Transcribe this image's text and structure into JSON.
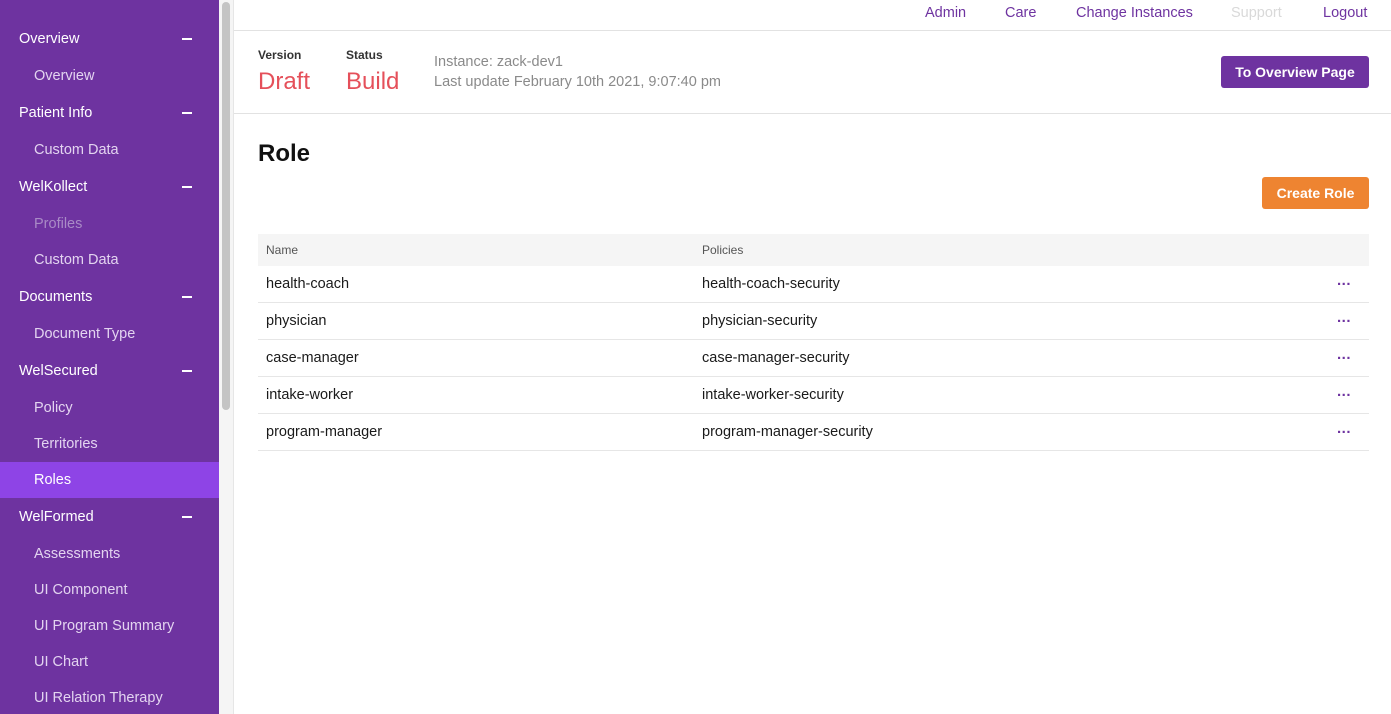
{
  "sidebar": {
    "groups": [
      {
        "label": "Overview",
        "items": [
          {
            "label": "Overview"
          }
        ]
      },
      {
        "label": "Patient Info",
        "items": [
          {
            "label": "Custom Data"
          }
        ]
      },
      {
        "label": "WelKollect",
        "items": [
          {
            "label": "Profiles"
          },
          {
            "label": "Custom Data"
          }
        ]
      },
      {
        "label": "Documents",
        "items": [
          {
            "label": "Document Type"
          }
        ]
      },
      {
        "label": "WelSecured",
        "items": [
          {
            "label": "Policy"
          },
          {
            "label": "Territories"
          },
          {
            "label": "Roles"
          }
        ]
      },
      {
        "label": "WelFormed",
        "items": [
          {
            "label": "Assessments"
          },
          {
            "label": "UI Component"
          },
          {
            "label": "UI Program Summary"
          },
          {
            "label": "UI Chart"
          },
          {
            "label": "UI Relation Therapy"
          }
        ]
      }
    ],
    "active_item": "Roles",
    "accent_color": "#6e33a0",
    "active_color": "#8e44e6"
  },
  "topnav": {
    "admin": "Admin",
    "care": "Care",
    "change_instances": "Change Instances",
    "support": "Support",
    "logout": "Logout"
  },
  "header": {
    "version_label": "Version",
    "version_value": "Draft",
    "status_label": "Status",
    "status_value": "Build",
    "instance": "Instance: zack-dev1",
    "last_update": "Last update February 10th 2021, 9:07:40 pm",
    "overview_button": "To Overview Page"
  },
  "main": {
    "title": "Role",
    "create_button": "Create Role",
    "table": {
      "headers": {
        "name": "Name",
        "policies": "Policies"
      },
      "rows": [
        {
          "name": "health-coach",
          "policies": "health-coach-security",
          "more": "..."
        },
        {
          "name": "physician",
          "policies": "physician-security",
          "more": "..."
        },
        {
          "name": "case-manager",
          "policies": "case-manager-security",
          "more": "..."
        },
        {
          "name": "intake-worker",
          "policies": "intake-worker-security",
          "more": "..."
        },
        {
          "name": "program-manager",
          "policies": "program-manager-security",
          "more": "..."
        }
      ]
    }
  }
}
